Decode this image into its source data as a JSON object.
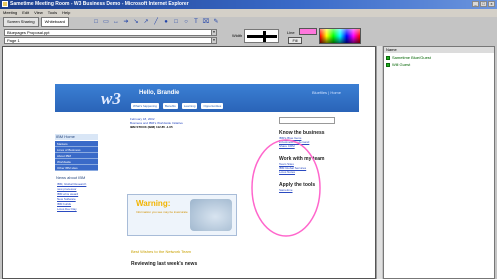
{
  "window": {
    "title": "Sametime Meeting Room - W3 Business Demo - Microsoft Internet Explorer",
    "controls": [
      "_",
      "□",
      "x"
    ]
  },
  "menu": [
    "Meeting",
    "Edit",
    "View",
    "Tools",
    "Help"
  ],
  "tabs": [
    "Screen Sharing",
    "Whiteboard"
  ],
  "tools": [
    "□",
    "▭",
    "↔",
    "➔",
    "↘",
    "↗",
    "╱",
    "●",
    "□",
    "○",
    "T",
    "⌧",
    "✎"
  ],
  "whiteboard": {
    "file_select": "Bluepages Proposal.ppt",
    "page_select": "Page 1",
    "width_label": "Width",
    "line_label": "Line",
    "fill_label": "Fill"
  },
  "site": {
    "logo": "w3",
    "greeting": "Hello, Brandie",
    "banner_links": "Bluefiles  |  Home",
    "nav_buttons": [
      "What's happening",
      "Benefits",
      "Learning",
      "Opportunities"
    ],
    "left_nav_header": "IBM Home",
    "left_nav": [
      "Markets",
      "Lines of Business",
      "About IBM",
      "Worldwide",
      "Other IBM sites"
    ],
    "news_header": "News about IBM",
    "news_items": [
      "IBM, Global Research",
      "new processor",
      "IBM wins award",
      "New Software",
      "IBM builds",
      "Lotus Dev Day"
    ],
    "feature_date": "February 18, 2002",
    "feature_text": "Business and IBM's Worldwide Initiative",
    "stock": "IBM STOCK (IBM) 112.85 -1.05",
    "warning_title": "Warning:",
    "warning_sub": "Information you see may be inaccurate",
    "eve_text": "Best Wishes to the Network Team",
    "review_title": "Reviewing last week's news",
    "right_headers": [
      "Know the business",
      "Work with my team",
      "Apply the tools"
    ],
    "right_links": [
      "IBM's Blue Gene",
      "e-business on demand",
      "Share CRM",
      "Team Sites",
      "IBM Global Services",
      "Lotus Notes",
      "Sametime"
    ]
  },
  "participants": {
    "header": "Name",
    "items": [
      "Sametime Blue/Guest",
      "Will Guest"
    ]
  }
}
